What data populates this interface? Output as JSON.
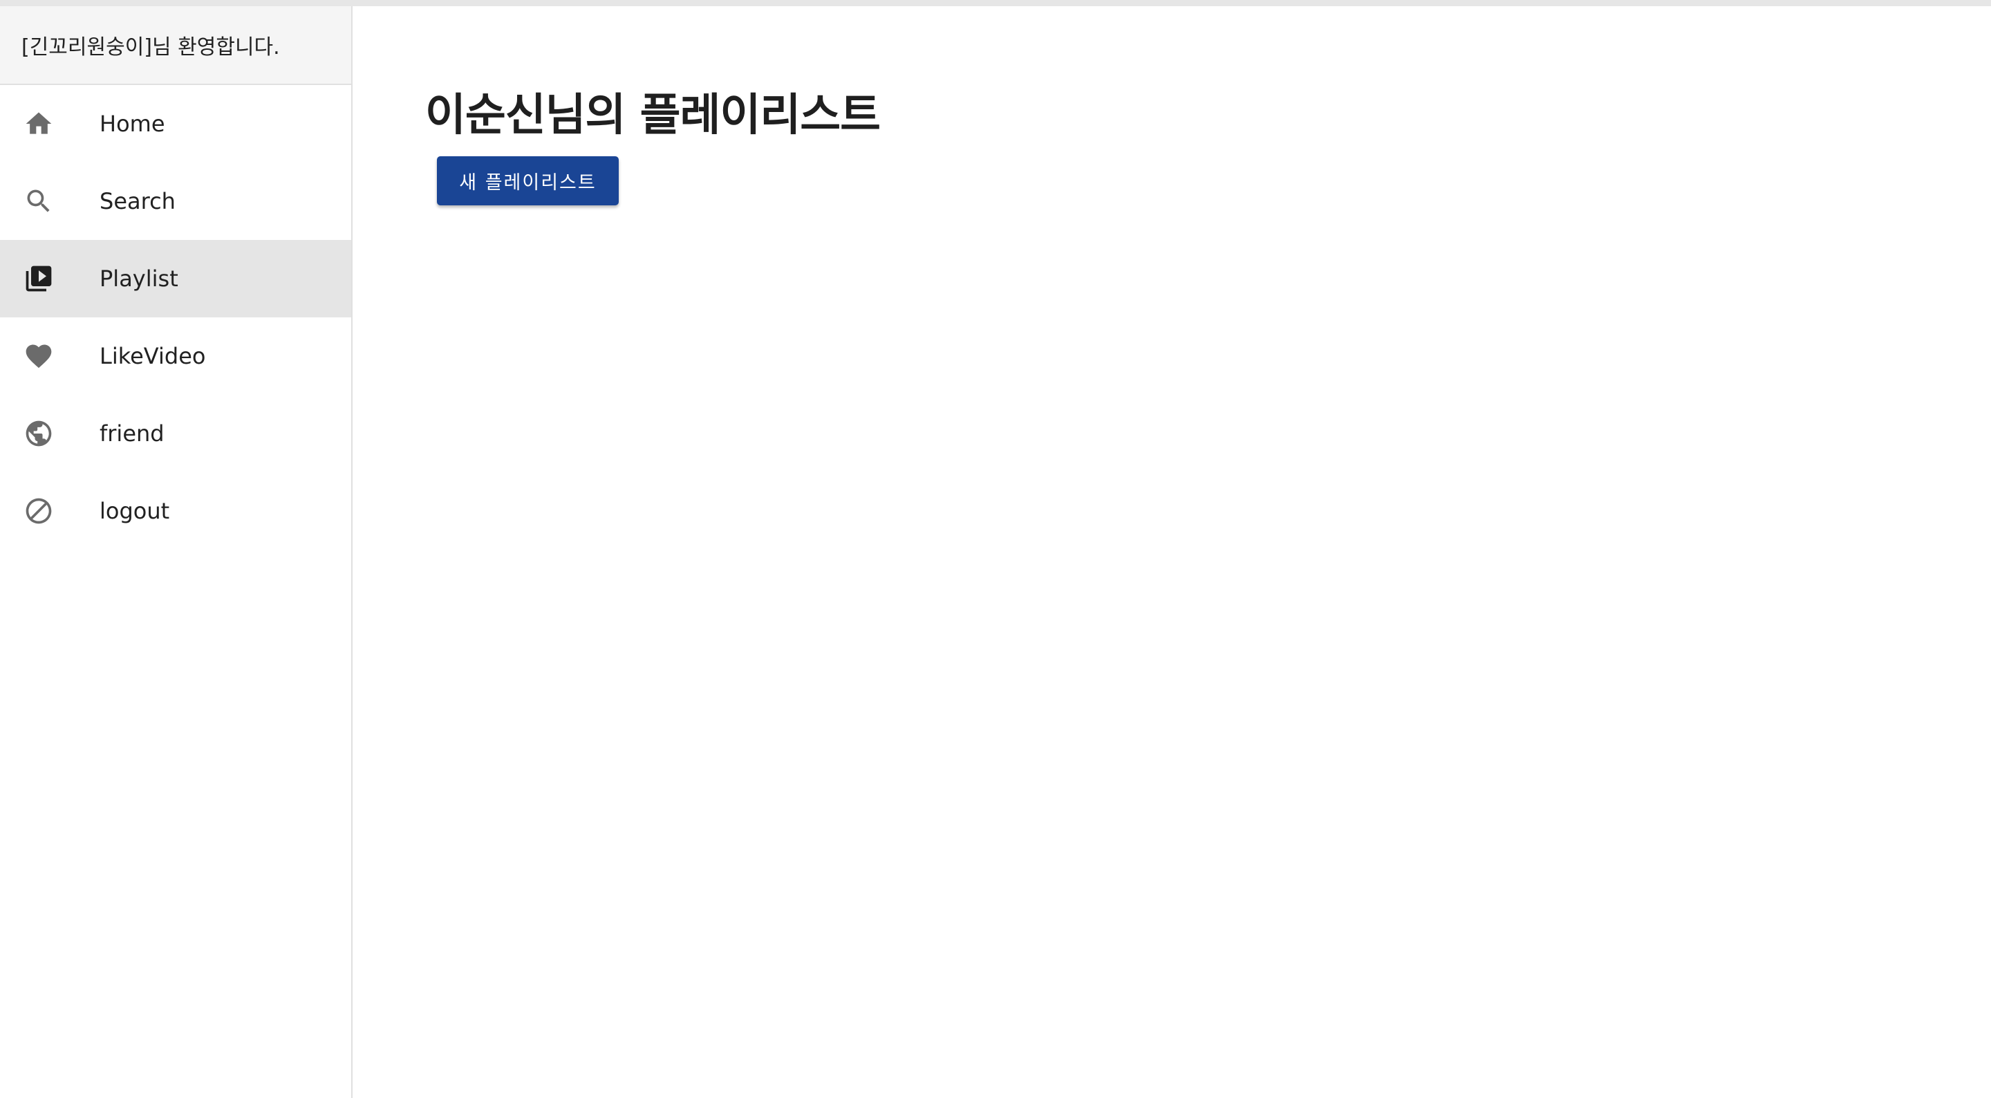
{
  "sidebar": {
    "welcome": "[긴꼬리원숭이]님 환영합니다.",
    "items": [
      {
        "label": "Home",
        "icon": "home-icon"
      },
      {
        "label": "Search",
        "icon": "search-icon"
      },
      {
        "label": "Playlist",
        "icon": "playlist-icon",
        "active": true
      },
      {
        "label": "LikeVideo",
        "icon": "heart-icon"
      },
      {
        "label": "friend",
        "icon": "globe-icon"
      },
      {
        "label": "logout",
        "icon": "block-icon"
      }
    ]
  },
  "main": {
    "title": "이순신님의 플레이리스트",
    "new_playlist_label": "새 플레이리스트"
  },
  "colors": {
    "accent": "#1a4595",
    "active_item_bg": "#e5e5e5",
    "icon": "#6b6b6b"
  }
}
